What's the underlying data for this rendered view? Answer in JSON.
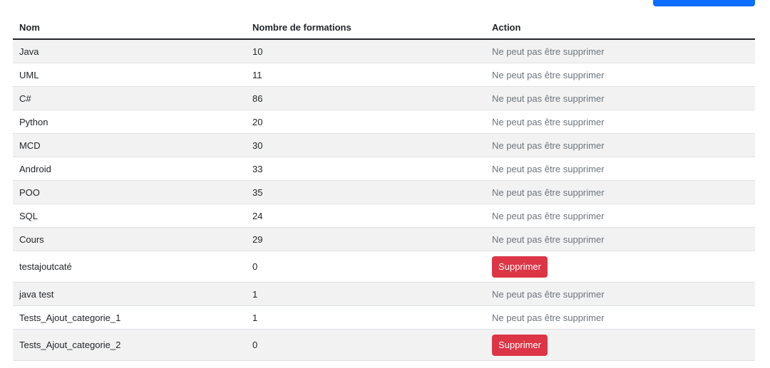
{
  "table": {
    "headers": [
      "Nom",
      "Nombre de formations",
      "Action"
    ],
    "rows": [
      {
        "nom": "Java",
        "count": "10",
        "action": "Ne peut pas être supprimer",
        "deletable": false
      },
      {
        "nom": "UML",
        "count": "11",
        "action": "Ne peut pas être supprimer",
        "deletable": false
      },
      {
        "nom": "C#",
        "count": "86",
        "action": "Ne peut pas être supprimer",
        "deletable": false
      },
      {
        "nom": "Python",
        "count": "20",
        "action": "Ne peut pas être supprimer",
        "deletable": false
      },
      {
        "nom": "MCD",
        "count": "30",
        "action": "Ne peut pas être supprimer",
        "deletable": false
      },
      {
        "nom": "Android",
        "count": "33",
        "action": "Ne peut pas être supprimer",
        "deletable": false
      },
      {
        "nom": "POO",
        "count": "35",
        "action": "Ne peut pas être supprimer",
        "deletable": false
      },
      {
        "nom": "SQL",
        "count": "24",
        "action": "Ne peut pas être supprimer",
        "deletable": false
      },
      {
        "nom": "Cours",
        "count": "29",
        "action": "Ne peut pas être supprimer",
        "deletable": false
      },
      {
        "nom": "testajoutcaté",
        "count": "0",
        "action": "Supprimer",
        "deletable": true
      },
      {
        "nom": "java test",
        "count": "1",
        "action": "Ne peut pas être supprimer",
        "deletable": false
      },
      {
        "nom": "Tests_Ajout_categorie_1",
        "count": "1",
        "action": "Ne peut pas être supprimer",
        "deletable": false
      },
      {
        "nom": "Tests_Ajout_categorie_2",
        "count": "0",
        "action": "Supprimer",
        "deletable": true
      }
    ]
  },
  "colors": {
    "primary": "#0d6efd",
    "danger": "#dc3545",
    "muted": "#6c757d",
    "stripe": "#f2f2f2"
  }
}
